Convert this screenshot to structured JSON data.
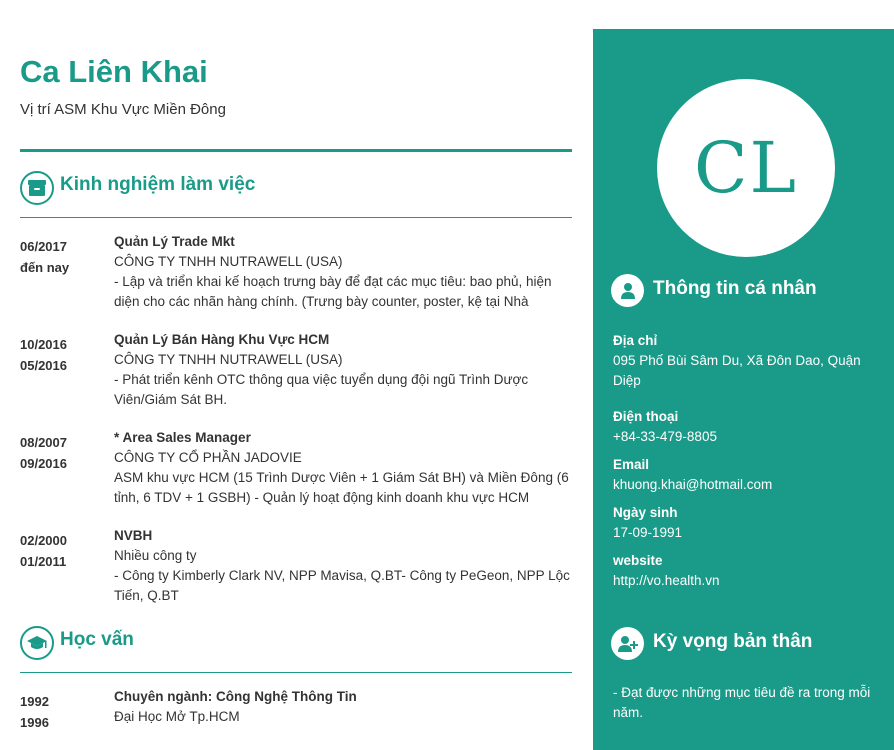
{
  "cv": {
    "name": "Ca Liên Khai",
    "position": "Vị trí  ASM Khu Vực Miền Đông",
    "initials": "CL"
  },
  "experience": {
    "title": "Kinh nghiệm làm việc",
    "entries": [
      {
        "start": "06/2017",
        "end": "đến nay",
        "role": "Quản Lý Trade Mkt",
        "company": "CÔNG TY TNHH NUTRAWELL (USA)",
        "desc": "- Lập và triển khai kế hoạch trưng bày để đạt các mục tiêu: bao phủ, hiện diện cho các nhãn hàng chính. (Trưng bày counter, poster, kệ tại Nhà"
      },
      {
        "start": "10/2016",
        "end": "05/2016",
        "role": "Quản Lý Bán Hàng Khu Vực HCM",
        "company": "CÔNG TY TNHH NUTRAWELL (USA)",
        "desc": "- Phát triển kênh OTC thông qua việc tuyển dụng đội ngũ Trình Dược Viên/Giám Sát BH."
      },
      {
        "start": "08/2007",
        "end": "09/2016",
        "role": " * Area Sales Manager",
        "company": "CÔNG TY CỔ PHẦN JADOVIE",
        "desc": "ASM khu vực HCM (15 Trình Dược Viên + 1 Giám Sát BH) và Miền Đông (6 tỉnh, 6 TDV + 1 GSBH) - Quản lý hoạt động kinh doanh khu vực HCM"
      },
      {
        "start": "02/2000",
        "end": "01/2011",
        "role": "NVBH",
        "company": "Nhiều công ty",
        "desc": "- Công ty Kimberly Clark NV, NPP Mavisa, Q.BT- Công ty PeGeon, NPP Lộc Tiến, Q.BT"
      }
    ]
  },
  "education": {
    "title": "Học vấn",
    "entries": [
      {
        "start": "1992",
        "end": "1996",
        "role": "Chuyên ngành: Công Nghệ Thông Tin",
        "school": "Đại Học Mở Tp.HCM"
      }
    ]
  },
  "personal": {
    "title": "Thông tin cá nhân",
    "address_label": "Địa chỉ",
    "address": "095 Phố Bùi Sâm Du, Xã Đôn Dao, Quận Diệp",
    "phone_label": "Điện thoại",
    "phone": "+84-33-479-8805",
    "email_label": "Email",
    "email": "khuong.khai@hotmail.com",
    "dob_label": "Ngày sinh",
    "dob": "17-09-1991",
    "website_label": "website",
    "website": "http://vo.health.vn"
  },
  "expectation": {
    "title": "Kỳ vọng bản thân",
    "text": "- Đạt được những mục tiêu đề ra trong mỗi năm."
  },
  "icons": {
    "experience": "archive-box-icon",
    "education": "graduation-cap-icon",
    "personal": "user-icon",
    "expectation": "user-plus-icon"
  },
  "colors": {
    "accent": "#1a9a88",
    "text": "#333333",
    "white": "#ffffff"
  }
}
